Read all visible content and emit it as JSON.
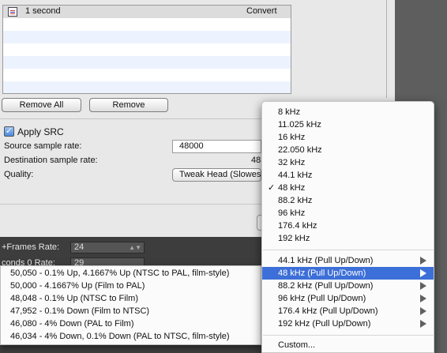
{
  "file_list": {
    "rows": [
      {
        "name": "1 second",
        "action": "Convert"
      }
    ]
  },
  "buttons": {
    "remove_all": "Remove All",
    "remove": "Remove"
  },
  "src": {
    "apply_label": "Apply SRC",
    "apply_checked": true,
    "source_label": "Source sample rate:",
    "source_value": "48000",
    "dest_label": "Destination sample rate:",
    "dest_value": "48",
    "quality_label": "Quality:",
    "quality_value": "Tweak Head (Slowest"
  },
  "background_window": {
    "frames_label": "+Frames Rate:",
    "frames_value": "24",
    "row2_label": "conds 0 Rate:",
    "row2_value": "29"
  },
  "rate_menu": {
    "items": [
      "8 kHz",
      "11.025 kHz",
      "16 kHz",
      "22.050 kHz",
      "32 kHz",
      "44.1 kHz",
      "48 kHz",
      "88.2 kHz",
      "96 kHz",
      "176.4 kHz",
      "192 kHz"
    ],
    "checked_item": "48 kHz",
    "pull_items": [
      "44.1 kHz (Pull Up/Down)",
      "48 kHz (Pull Up/Down)",
      "88.2 kHz (Pull Up/Down)",
      "96 kHz (Pull Up/Down)",
      "176.4 kHz (Pull Up/Down)",
      "192 kHz (Pull Up/Down)"
    ],
    "highlighted_pull_item": "48 kHz (Pull Up/Down)",
    "custom": "Custom..."
  },
  "pull_submenu": {
    "items": [
      "50,050 - 0.1% Up, 4.1667% Up (NTSC to PAL, film-style)",
      "50,000 - 4.1667% Up (Film to PAL)",
      "48,048 - 0.1% Up (NTSC to Film)",
      "47,952 - 0.1% Down (Film to NTSC)",
      "46,080 - 4% Down (PAL to Film)",
      "46,034 - 4% Down, 0.1% Down (PAL to NTSC, film-style)"
    ]
  },
  "colors": {
    "highlight": "#3d6fd8",
    "list_stripe": "#edf3fe"
  }
}
